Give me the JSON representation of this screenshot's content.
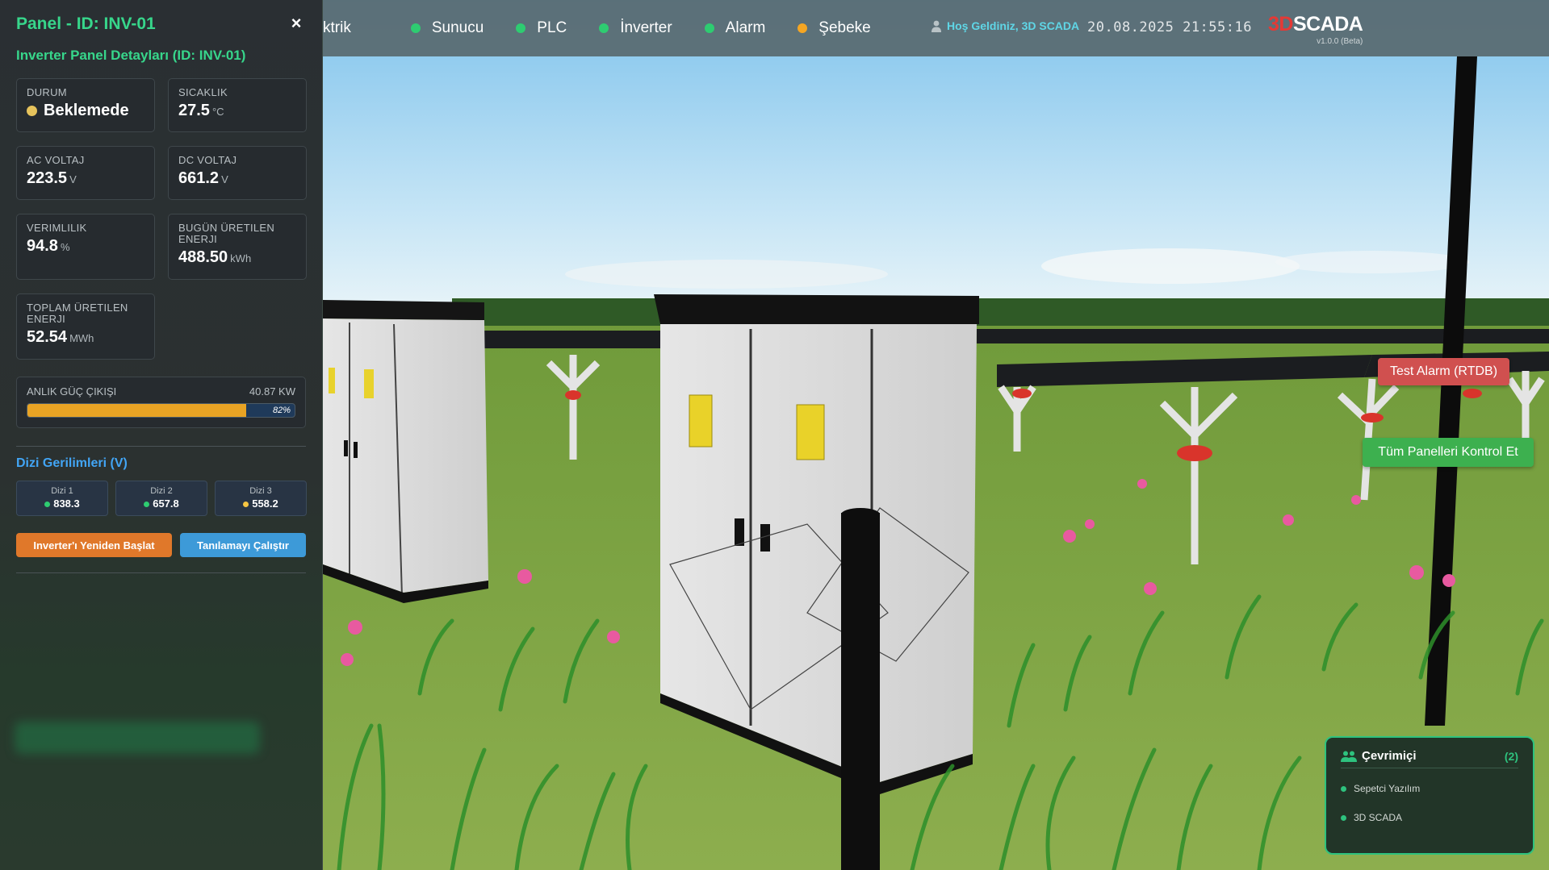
{
  "colors": {
    "accent_green": "#37d68b",
    "status_green": "#2ecc71",
    "status_orange": "#f5a623",
    "state_idle": "#e6c35c",
    "info_blue": "#42a5f5",
    "alarm_red": "#d0504f",
    "brand_red": "#e53935"
  },
  "topbar": {
    "partial_label": "ktrik",
    "statuses": [
      {
        "label": "Sunucu",
        "color": "#2ecc71"
      },
      {
        "label": "PLC",
        "color": "#2ecc71"
      },
      {
        "label": "İnverter",
        "color": "#2ecc71"
      },
      {
        "label": "Alarm",
        "color": "#2ecc71"
      },
      {
        "label": "Şebeke",
        "color": "#f5a623"
      }
    ],
    "user_icon": "user-icon",
    "welcome": "Hoş Geldiniz, 3D SCADA",
    "datetime": "20.08.2025 21:55:16",
    "brand_prefix": "3D",
    "brand_name": "SCADA",
    "version": "v1.0.0 (Beta)"
  },
  "panel": {
    "title": "Panel - ID: INV-01",
    "close_icon": "close-icon",
    "close_glyph": "×",
    "detail_title": "Inverter Panel Detayları (ID: INV-01)",
    "cards": {
      "status": {
        "label": "DURUM",
        "value": "Beklemede"
      },
      "temperature": {
        "label": "SICAKLIK",
        "value": "27.5",
        "unit": "°C"
      },
      "ac_voltage": {
        "label": "AC VOLTAJ",
        "value": "223.5",
        "unit": "V"
      },
      "dc_voltage": {
        "label": "DC VOLTAJ",
        "value": "661.2",
        "unit": "V"
      },
      "efficiency": {
        "label": "VERIMLILIK",
        "value": "94.8",
        "unit": "%"
      },
      "today_energy": {
        "label": "BUGÜN ÜRETILEN ENERJI",
        "value": "488.50",
        "unit": "kWh"
      },
      "total_energy": {
        "label": "TOPLAM ÜRETILEN ENERJI",
        "value": "52.54",
        "unit": "MWh"
      }
    },
    "power": {
      "label": "ANLIK GÜÇ ÇIKIŞI",
      "value": "40.87 KW",
      "percent": 82,
      "percent_label": "82%"
    },
    "strings_title": "Dizi Gerilimleri (V)",
    "strings": [
      {
        "name": "Dizi 1",
        "value": "838.3",
        "color": "#2ecc71"
      },
      {
        "name": "Dizi 2",
        "value": "657.8",
        "color": "#2ecc71"
      },
      {
        "name": "Dizi 3",
        "value": "558.2",
        "color": "#f5c542"
      }
    ],
    "restart_label": "Inverter'ı Yeniden Başlat",
    "diagnose_label": "Tanılamayı Çalıştır"
  },
  "scene_buttons": {
    "alarm_label": "Test Alarm (RTDB)",
    "check_label": "Tüm Panelleri Kontrol Et"
  },
  "online": {
    "icon": "users-icon",
    "title": "Çevrimiçi",
    "count": "(2)",
    "users": [
      "Sepetci Yazılım",
      "3D SCADA"
    ]
  }
}
